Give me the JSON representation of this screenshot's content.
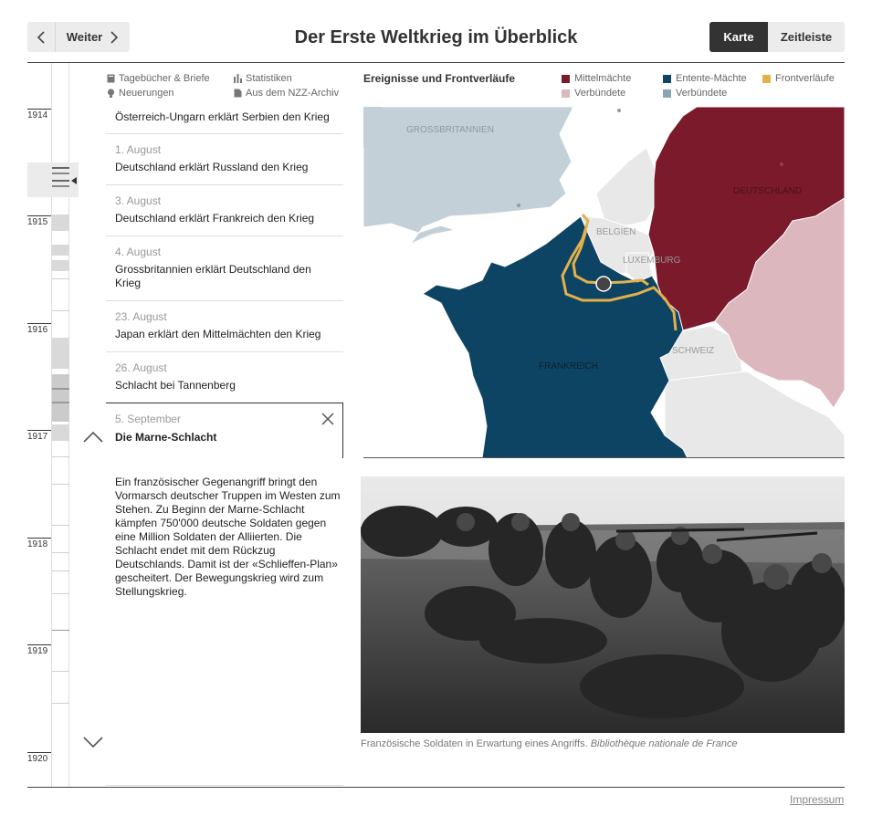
{
  "header": {
    "next_label": "Weiter",
    "title": "Der Erste Weltkrieg im Überblick",
    "view_map": "Karte",
    "view_timeline": "Zeitleiste"
  },
  "timeline": {
    "years": [
      "1914",
      "1915",
      "1916",
      "1917",
      "1918",
      "1919",
      "1920"
    ]
  },
  "filters": {
    "diaries": "Tagebücher & Briefe",
    "stats": "Statistiken",
    "innovations": "Neuerungen",
    "archive": "Aus dem NZZ-Archiv"
  },
  "events": [
    {
      "date": "",
      "text": "Österreich-Ungarn erklärt Serbien den Krieg"
    },
    {
      "date": "1. August",
      "text": "Deutschland erklärt Russland den Krieg"
    },
    {
      "date": "3. August",
      "text": "Deutschland erklärt Frankreich den Krieg"
    },
    {
      "date": "4. August",
      "text": "Grossbritannien erklärt Deutschland den Krieg"
    },
    {
      "date": "23. August",
      "text": "Japan erklärt den Mittelmächten den Krieg"
    },
    {
      "date": "26. August",
      "text": "Schlacht bei Tannenberg"
    }
  ],
  "active_event": {
    "date": "5. September",
    "title": "Die Marne-Schlacht",
    "description": "Ein französischer Gegenangriff bringt den Vormarsch deutscher Truppen im Westen zum Stehen. Zu Beginn der Marne-Schlacht kämpfen 750'000 deutsche Soldaten gegen eine Million Soldaten der Alliierten. Die Schlacht endet mit dem Rückzug Deutschlands. Damit ist der «Schlieffen-Plan» gescheitert. Der Bewegungskrieg wird zum Stellungskrieg."
  },
  "map": {
    "heading": "Ereignisse und Frontverläufe",
    "legend": {
      "central": "Mittelmächte",
      "central_allies": "Verbündete",
      "entente": "Entente-Mächte",
      "entente_allies": "Verbündete",
      "front": "Frontverläufe"
    },
    "colors": {
      "central": "#7b1a2b",
      "central_allies": "#dcb7bd",
      "entente": "#0e4463",
      "entente_allies": "#8aa4b2",
      "front": "#e3b04b",
      "britain": "#c3d0d8",
      "neutral": "#e8e8e8"
    },
    "labels": {
      "britain": "GROSSBRITANNIEN",
      "germany": "DEUTSCHLAND",
      "belgium": "BELGIEN",
      "luxembourg": "LUXEMBURG",
      "switzerland": "SCHWEIZ",
      "france": "FRANKREICH"
    }
  },
  "photo": {
    "caption": "Französische Soldaten in Erwartung eines Angriffs.",
    "source": "Bibliothèque nationale de France"
  },
  "footer": {
    "impressum": "Impressum"
  }
}
